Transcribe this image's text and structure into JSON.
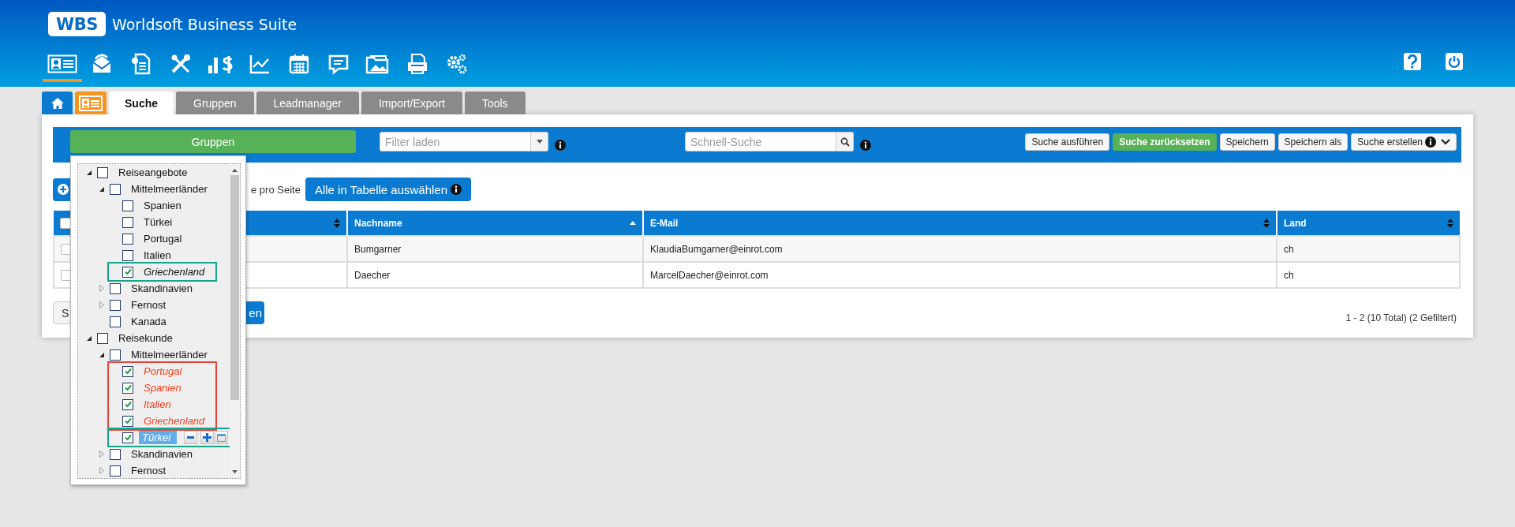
{
  "app": {
    "logo": "WBS",
    "title": "Worldsoft Business Suite"
  },
  "nav": [
    {
      "selected": true
    },
    {
      "selected": false
    },
    {
      "selected": false
    },
    {
      "selected": false
    },
    {
      "selected": false
    },
    {
      "selected": false
    },
    {
      "selected": false
    },
    {
      "selected": false
    },
    {
      "selected": false
    },
    {
      "selected": false
    },
    {
      "selected": false
    }
  ],
  "tabs": [
    {
      "kind": "home",
      "selected": false
    },
    {
      "kind": "contacts",
      "selected": false
    },
    {
      "kind": "text",
      "label": "Suche",
      "selected": true
    },
    {
      "kind": "text",
      "label": "Gruppen",
      "selected": false
    },
    {
      "kind": "text",
      "label": "Leadmanager",
      "selected": false
    },
    {
      "kind": "text",
      "label": "Import/Export",
      "selected": false
    },
    {
      "kind": "text",
      "label": "Tools",
      "selected": false
    }
  ],
  "toolbar": {
    "groups_button": "Gruppen",
    "filter": {
      "placeholder": "Filter laden"
    },
    "search": {
      "placeholder": "Schnell-Suche"
    },
    "buttons": [
      {
        "label": "Suche ausführen",
        "kind": "default"
      },
      {
        "label": "Suche zurücksetzen",
        "kind": "success"
      },
      {
        "label": "Speichern",
        "kind": "default"
      },
      {
        "label": "Speichern als",
        "kind": "default"
      },
      {
        "label": "Suche erstellen",
        "kind": "menu"
      }
    ]
  },
  "actions": {
    "per_page_label": "e pro Seite",
    "select_all_button": "Alle in Tabelle auswählen"
  },
  "table": {
    "all_checked": false,
    "columns": [
      {
        "kind": "check"
      },
      {
        "kind": "covered",
        "sorted": false
      },
      {
        "kind": "text",
        "label": "Nachname",
        "sorted": true
      },
      {
        "kind": "text",
        "label": "E-Mail",
        "sorted": false
      },
      {
        "kind": "text",
        "label": "Land",
        "sorted": false
      }
    ],
    "rows": [
      {
        "checked": false,
        "cells": [
          "",
          "",
          "Bumgarner",
          "KlaudiaBumgarner@einrot.com",
          "ch"
        ]
      },
      {
        "checked": false,
        "cells": [
          "",
          "",
          "Daecher",
          "MarcelDaecher@einrot.com",
          "ch"
        ]
      }
    ]
  },
  "footer": {
    "left_button": "S",
    "right_button": "en",
    "pagination": "1 - 2 (10 Total) (2 Gefiltert)"
  },
  "group_tree": {
    "items": [
      {
        "label": "Reiseangebote",
        "checked": false,
        "expanded": true,
        "selected": false,
        "children": [
          {
            "label": "Mittelmeerländer",
            "checked": false,
            "expanded": true,
            "selected": false,
            "children": [
              {
                "label": "Spanien",
                "checked": false,
                "selected": false
              },
              {
                "label": "Türkei",
                "checked": false,
                "selected": false
              },
              {
                "label": "Portugal",
                "checked": false,
                "selected": false
              },
              {
                "label": "Italien",
                "checked": false,
                "selected": false
              },
              {
                "label": "Griechenland",
                "checked": true,
                "selected": false,
                "color": "#17a589"
              }
            ]
          },
          {
            "label": "Skandinavien",
            "checked": false,
            "expanded": false,
            "selected": false
          },
          {
            "label": "Fernost",
            "checked": false,
            "expanded": false,
            "selected": false
          },
          {
            "label": "Kanada",
            "checked": false,
            "selected": false
          }
        ]
      },
      {
        "label": "Reisekunde",
        "checked": false,
        "expanded": true,
        "selected": false,
        "children": [
          {
            "label": "Mittelmeerländer",
            "checked": false,
            "expanded": true,
            "selected": false,
            "children": [
              {
                "label": "Portugal",
                "checked": true,
                "selected": false,
                "alert": true,
                "color": "#e8453c"
              },
              {
                "label": "Spanien",
                "checked": true,
                "selected": false,
                "alert": true,
                "color": "#e8453c"
              },
              {
                "label": "Italien",
                "checked": true,
                "selected": false,
                "alert": true,
                "color": "#e8453c"
              },
              {
                "label": "Griechenland",
                "checked": true,
                "selected": false,
                "alert": true,
                "color": "#e8453c"
              },
              {
                "label": "Türkei",
                "checked": true,
                "selected": true,
                "color": "#17a589"
              }
            ]
          },
          {
            "label": "Skandinavien",
            "checked": false,
            "expanded": false,
            "selected": false
          },
          {
            "label": "Fernost",
            "checked": false,
            "expanded": false,
            "selected": false
          }
        ]
      }
    ]
  }
}
